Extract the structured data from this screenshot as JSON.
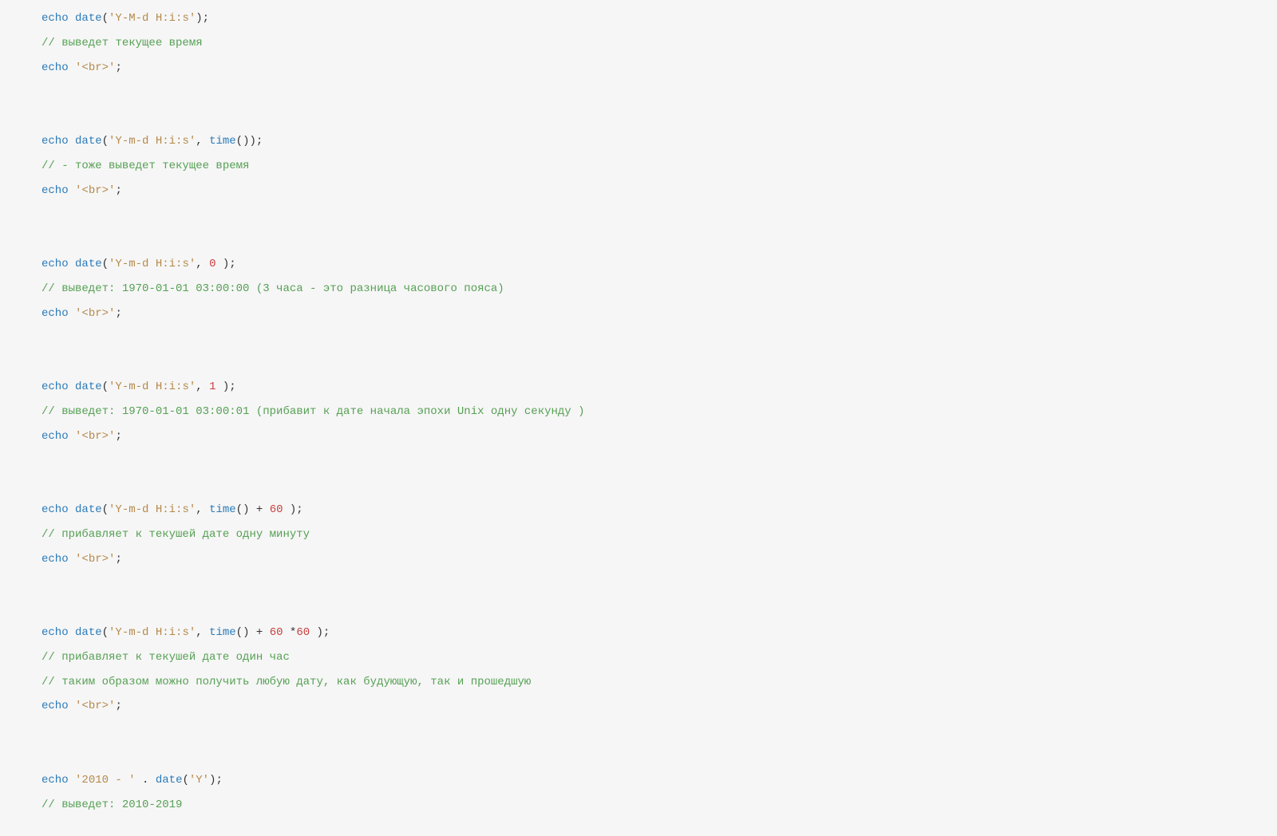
{
  "code": {
    "lines": [
      [
        {
          "t": "echo",
          "c": "kw"
        },
        {
          "t": " ",
          "c": ""
        },
        {
          "t": "date",
          "c": "kw"
        },
        {
          "t": "(",
          "c": "t-par"
        },
        {
          "t": "'Y-M-d H:i:s'",
          "c": "str"
        },
        {
          "t": ");",
          "c": "t-par"
        }
      ],
      [
        {
          "t": "// выведет текущее время",
          "c": "cmt"
        }
      ],
      [
        {
          "t": "echo",
          "c": "kw"
        },
        {
          "t": " ",
          "c": ""
        },
        {
          "t": "'<br>'",
          "c": "str"
        },
        {
          "t": ";",
          "c": "t-par"
        }
      ],
      [
        {
          "t": "",
          "c": ""
        }
      ],
      [
        {
          "t": "",
          "c": ""
        }
      ],
      [
        {
          "t": "echo",
          "c": "kw"
        },
        {
          "t": " ",
          "c": ""
        },
        {
          "t": "date",
          "c": "kw"
        },
        {
          "t": "(",
          "c": "t-par"
        },
        {
          "t": "'Y-m-d H:i:s'",
          "c": "str"
        },
        {
          "t": ", ",
          "c": "t-par"
        },
        {
          "t": "time",
          "c": "kw"
        },
        {
          "t": "());",
          "c": "t-par"
        }
      ],
      [
        {
          "t": "// - тоже выведет текущее время",
          "c": "cmt"
        }
      ],
      [
        {
          "t": "echo",
          "c": "kw"
        },
        {
          "t": " ",
          "c": ""
        },
        {
          "t": "'<br>'",
          "c": "str"
        },
        {
          "t": ";",
          "c": "t-par"
        }
      ],
      [
        {
          "t": "",
          "c": ""
        }
      ],
      [
        {
          "t": "",
          "c": ""
        }
      ],
      [
        {
          "t": "echo",
          "c": "kw"
        },
        {
          "t": " ",
          "c": ""
        },
        {
          "t": "date",
          "c": "kw"
        },
        {
          "t": "(",
          "c": "t-par"
        },
        {
          "t": "'Y-m-d H:i:s'",
          "c": "str"
        },
        {
          "t": ", ",
          "c": "t-par"
        },
        {
          "t": "0",
          "c": "num"
        },
        {
          "t": " );",
          "c": "t-par"
        }
      ],
      [
        {
          "t": "// выведет: 1970-01-01 03:00:00 (3 часа - это разница часового пояса)",
          "c": "cmt"
        }
      ],
      [
        {
          "t": "echo",
          "c": "kw"
        },
        {
          "t": " ",
          "c": ""
        },
        {
          "t": "'<br>'",
          "c": "str"
        },
        {
          "t": ";",
          "c": "t-par"
        }
      ],
      [
        {
          "t": "",
          "c": ""
        }
      ],
      [
        {
          "t": "",
          "c": ""
        }
      ],
      [
        {
          "t": "echo",
          "c": "kw"
        },
        {
          "t": " ",
          "c": ""
        },
        {
          "t": "date",
          "c": "kw"
        },
        {
          "t": "(",
          "c": "t-par"
        },
        {
          "t": "'Y-m-d H:i:s'",
          "c": "str"
        },
        {
          "t": ", ",
          "c": "t-par"
        },
        {
          "t": "1",
          "c": "num"
        },
        {
          "t": " );",
          "c": "t-par"
        }
      ],
      [
        {
          "t": "// выведет: 1970-01-01 03:00:01 (прибавит к дате начала эпохи Unix одну секунду )",
          "c": "cmt"
        }
      ],
      [
        {
          "t": "echo",
          "c": "kw"
        },
        {
          "t": " ",
          "c": ""
        },
        {
          "t": "'<br>'",
          "c": "str"
        },
        {
          "t": ";",
          "c": "t-par"
        }
      ],
      [
        {
          "t": "",
          "c": ""
        }
      ],
      [
        {
          "t": "",
          "c": ""
        }
      ],
      [
        {
          "t": "echo",
          "c": "kw"
        },
        {
          "t": " ",
          "c": ""
        },
        {
          "t": "date",
          "c": "kw"
        },
        {
          "t": "(",
          "c": "t-par"
        },
        {
          "t": "'Y-m-d H:i:s'",
          "c": "str"
        },
        {
          "t": ", ",
          "c": "t-par"
        },
        {
          "t": "time",
          "c": "kw"
        },
        {
          "t": "() + ",
          "c": "t-par"
        },
        {
          "t": "60",
          "c": "num"
        },
        {
          "t": " );",
          "c": "t-par"
        }
      ],
      [
        {
          "t": "// прибавляет к текушей дате одну минуту",
          "c": "cmt"
        }
      ],
      [
        {
          "t": "echo",
          "c": "kw"
        },
        {
          "t": " ",
          "c": ""
        },
        {
          "t": "'<br>'",
          "c": "str"
        },
        {
          "t": ";",
          "c": "t-par"
        }
      ],
      [
        {
          "t": "",
          "c": ""
        }
      ],
      [
        {
          "t": "",
          "c": ""
        }
      ],
      [
        {
          "t": "echo",
          "c": "kw"
        },
        {
          "t": " ",
          "c": ""
        },
        {
          "t": "date",
          "c": "kw"
        },
        {
          "t": "(",
          "c": "t-par"
        },
        {
          "t": "'Y-m-d H:i:s'",
          "c": "str"
        },
        {
          "t": ", ",
          "c": "t-par"
        },
        {
          "t": "time",
          "c": "kw"
        },
        {
          "t": "() + ",
          "c": "t-par"
        },
        {
          "t": "60",
          "c": "num"
        },
        {
          "t": " *",
          "c": "t-par"
        },
        {
          "t": "60",
          "c": "num"
        },
        {
          "t": " );",
          "c": "t-par"
        }
      ],
      [
        {
          "t": "// прибавляет к текушей дате один час",
          "c": "cmt"
        }
      ],
      [
        {
          "t": "// таким образом можно получить любую дату, как будующую, так и прошедшую",
          "c": "cmt"
        }
      ],
      [
        {
          "t": "echo",
          "c": "kw"
        },
        {
          "t": " ",
          "c": ""
        },
        {
          "t": "'<br>'",
          "c": "str"
        },
        {
          "t": ";",
          "c": "t-par"
        }
      ],
      [
        {
          "t": "",
          "c": ""
        }
      ],
      [
        {
          "t": "",
          "c": ""
        }
      ],
      [
        {
          "t": "echo",
          "c": "kw"
        },
        {
          "t": " ",
          "c": ""
        },
        {
          "t": "'2010 - '",
          "c": "str"
        },
        {
          "t": " . ",
          "c": "t-par"
        },
        {
          "t": "date",
          "c": "kw"
        },
        {
          "t": "(",
          "c": "t-par"
        },
        {
          "t": "'Y'",
          "c": "str"
        },
        {
          "t": ");",
          "c": "t-par"
        }
      ],
      [
        {
          "t": "// выведет: 2010-2019",
          "c": "cmt"
        }
      ]
    ]
  }
}
